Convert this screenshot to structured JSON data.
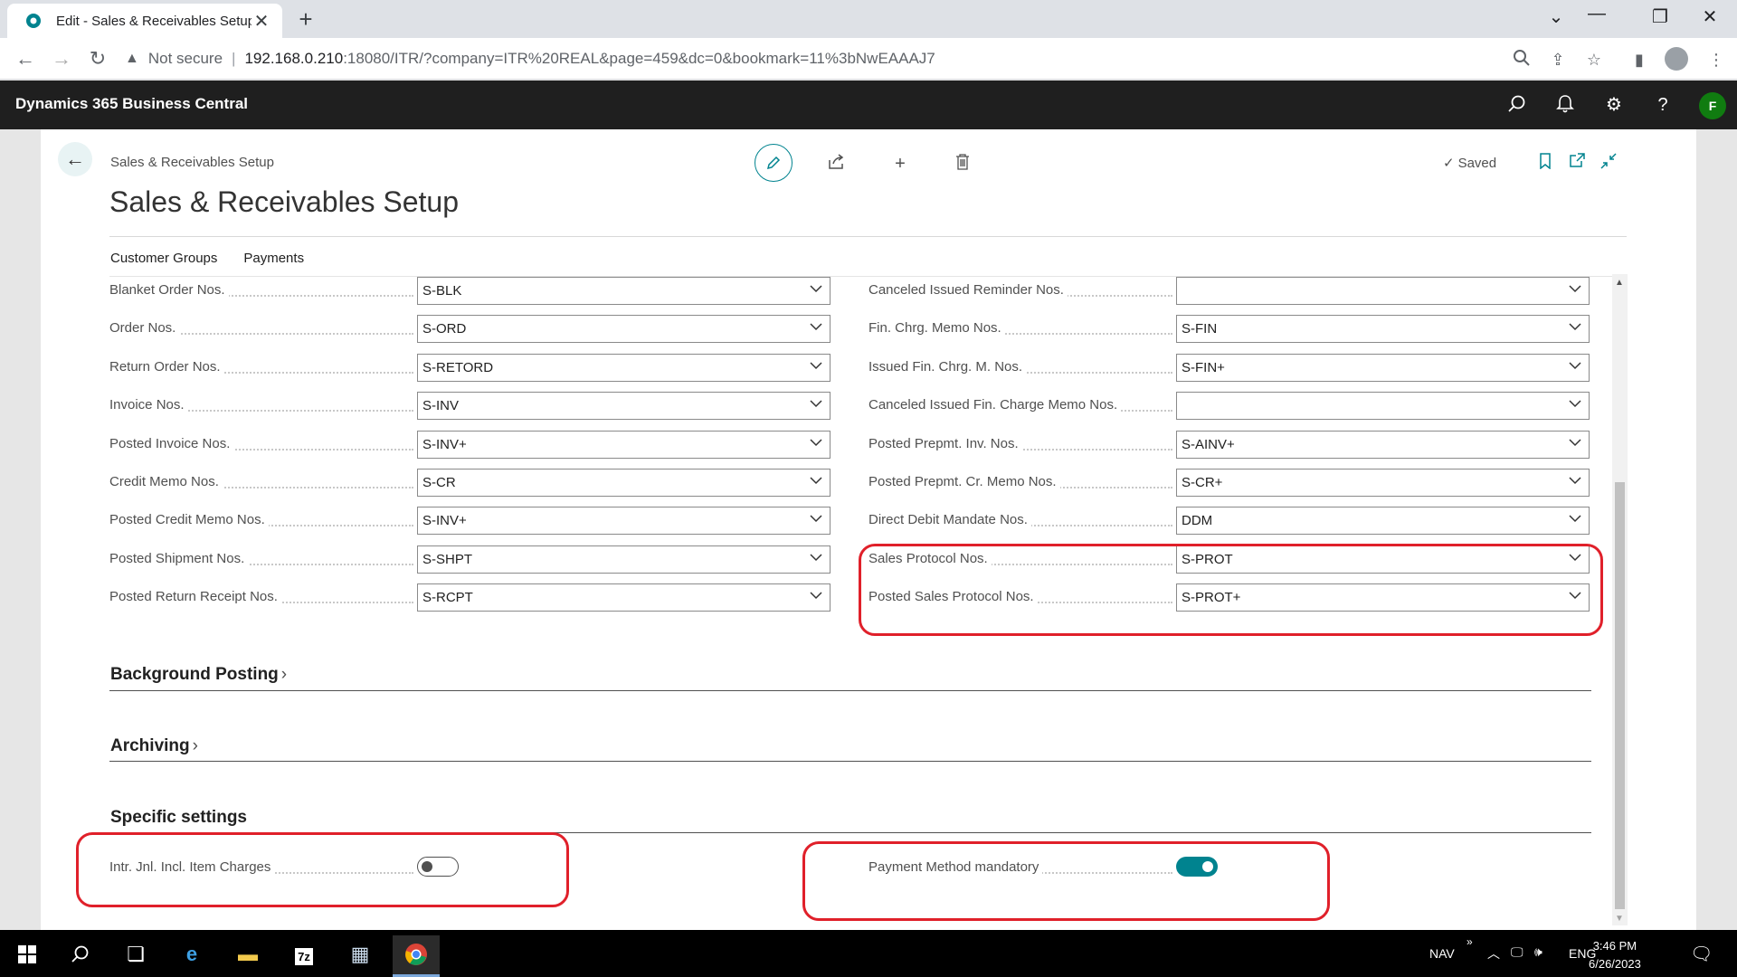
{
  "browser": {
    "tab_title": "Edit - Sales & Receivables Setup",
    "tab_close": "✕",
    "new_tab": "+",
    "not_secure": "Not secure",
    "url_host": "192.168.0.210",
    "url_rest": ":18080/ITR/?company=ITR%20REAL&page=459&dc=0&bookmark=11%3bNwEAAAJ7"
  },
  "app": {
    "title": "Dynamics 365 Business Central",
    "user_initial": "F"
  },
  "page": {
    "breadcrumb": "Sales & Receivables Setup",
    "title": "Sales & Receivables Setup",
    "saved_label": "Saved",
    "subnav": [
      "Customer Groups",
      "Payments"
    ]
  },
  "left_fields": [
    {
      "label": "Blanket Order Nos.",
      "value": "S-BLK"
    },
    {
      "label": "Order Nos.",
      "value": "S-ORD"
    },
    {
      "label": "Return Order Nos.",
      "value": "S-RETORD"
    },
    {
      "label": "Invoice Nos.",
      "value": "S-INV"
    },
    {
      "label": "Posted Invoice Nos.",
      "value": "S-INV+"
    },
    {
      "label": "Credit Memo Nos.",
      "value": "S-CR"
    },
    {
      "label": "Posted Credit Memo Nos.",
      "value": "S-INV+"
    },
    {
      "label": "Posted Shipment Nos.",
      "value": "S-SHPT"
    },
    {
      "label": "Posted Return Receipt Nos.",
      "value": "S-RCPT"
    }
  ],
  "right_fields": [
    {
      "label": "Canceled Issued Reminder Nos.",
      "value": ""
    },
    {
      "label": "Fin. Chrg. Memo Nos.",
      "value": "S-FIN"
    },
    {
      "label": "Issued Fin. Chrg. M. Nos.",
      "value": "S-FIN+"
    },
    {
      "label": "Canceled Issued Fin. Charge Memo Nos.",
      "value": ""
    },
    {
      "label": "Posted Prepmt. Inv. Nos.",
      "value": "S-AINV+"
    },
    {
      "label": "Posted Prepmt. Cr. Memo Nos.",
      "value": "S-CR+"
    },
    {
      "label": "Direct Debit Mandate Nos.",
      "value": "DDM"
    },
    {
      "label": "Sales Protocol Nos.",
      "value": "S-PROT"
    },
    {
      "label": "Posted Sales Protocol Nos.",
      "value": "S-PROT+"
    }
  ],
  "sections": {
    "background_posting": "Background Posting",
    "archiving": "Archiving",
    "specific_settings": "Specific settings"
  },
  "toggles": {
    "intr_jnl": {
      "label": "Intr. Jnl. Incl. Item Charges",
      "on": false
    },
    "payment_method": {
      "label": "Payment Method mandatory",
      "on": true
    }
  },
  "taskbar": {
    "nav_label": "NAV",
    "lang": "ENG",
    "time": "3:46 PM",
    "date": "6/26/2023",
    "app_7z": "7z"
  },
  "colors": {
    "accent": "#00838f",
    "appbar": "#1f1f1f",
    "highlight": "#e0202a",
    "avatar": "#107c10"
  }
}
